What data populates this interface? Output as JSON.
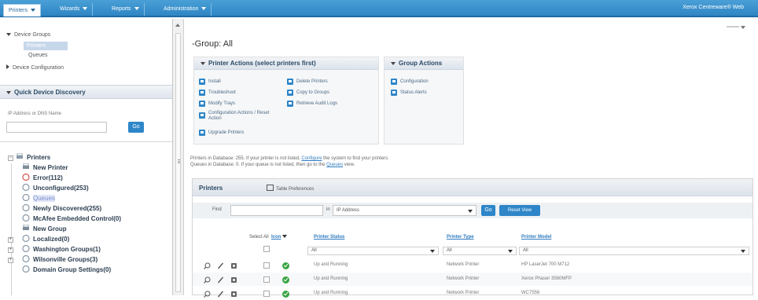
{
  "nav": {
    "menus": [
      {
        "label": "Printers"
      },
      {
        "label": "Wizards"
      },
      {
        "label": "Reports"
      },
      {
        "label": "Administration"
      }
    ],
    "user": "Xerox Centreware® Web"
  },
  "left": {
    "device_groups": "Device Groups",
    "printers": "Printers",
    "queues": "Queues",
    "device_configuration": "Device Configuration",
    "quick_discovery_title": "Quick Device Discovery",
    "ip_label": "IP Address or DNS Name",
    "ip_value": "",
    "go": "Go",
    "tree": {
      "root": "Printers",
      "items": [
        "New Printer",
        "Error(112)",
        "Unconfigured(253)",
        "Queues",
        "Newly Discovered(255)",
        "McAfee Embedded Control(0)",
        "New Group",
        "Localized(0)",
        "Washington Groups(1)",
        "Wilsonville Groups(3)",
        "Domain Group Settings(0)"
      ]
    }
  },
  "main": {
    "title": "-Group: All",
    "printer_actions": {
      "title": "Printer Actions (select printers first)",
      "col1": [
        "Install",
        "Troubleshoot",
        "Modify Trays",
        "Configuration Actions / Reset Action",
        "Upgrade Printers"
      ],
      "col2": [
        "Delete Printers",
        "Copy to Groups",
        "Retrieve Audit Logs"
      ]
    },
    "group_actions": {
      "title": "Group Actions",
      "items": [
        "Configuration",
        "Status Alerts"
      ]
    },
    "info_line1_a": "Printers in Database: 255. If your printer is not listed, ",
    "info_line1_link": "Configure",
    "info_line1_b": " the system to find your printers.",
    "info_line2_a": "Queues in Database: 0. If your queue is not listed, then go to the ",
    "info_line2_link": "Queues",
    "info_line2_b": " view.",
    "printers_panel": {
      "title": "Printers",
      "table_pref": "Table Preferences",
      "find_label": "Find",
      "find_value": "",
      "in_label": "in",
      "in_value": "IP Address",
      "go": "Go",
      "reset": "Reset View",
      "headers": {
        "select_all": "Select All",
        "icon": "Icon",
        "status": "Printer Status",
        "type": "Printer Type",
        "model": "Printer Model"
      },
      "filters": {
        "status": "All",
        "type": "All",
        "model": "All"
      },
      "rows": [
        {
          "status": "Up and Running",
          "type": "Network Printer",
          "model": "HP LaserJet 700 M712"
        },
        {
          "status": "Up and Running",
          "type": "Network Printer",
          "model": "Xerox Phaser 3560MFP"
        },
        {
          "status": "Up and Running",
          "type": "Network Printer",
          "model": "WC7556"
        }
      ]
    }
  }
}
